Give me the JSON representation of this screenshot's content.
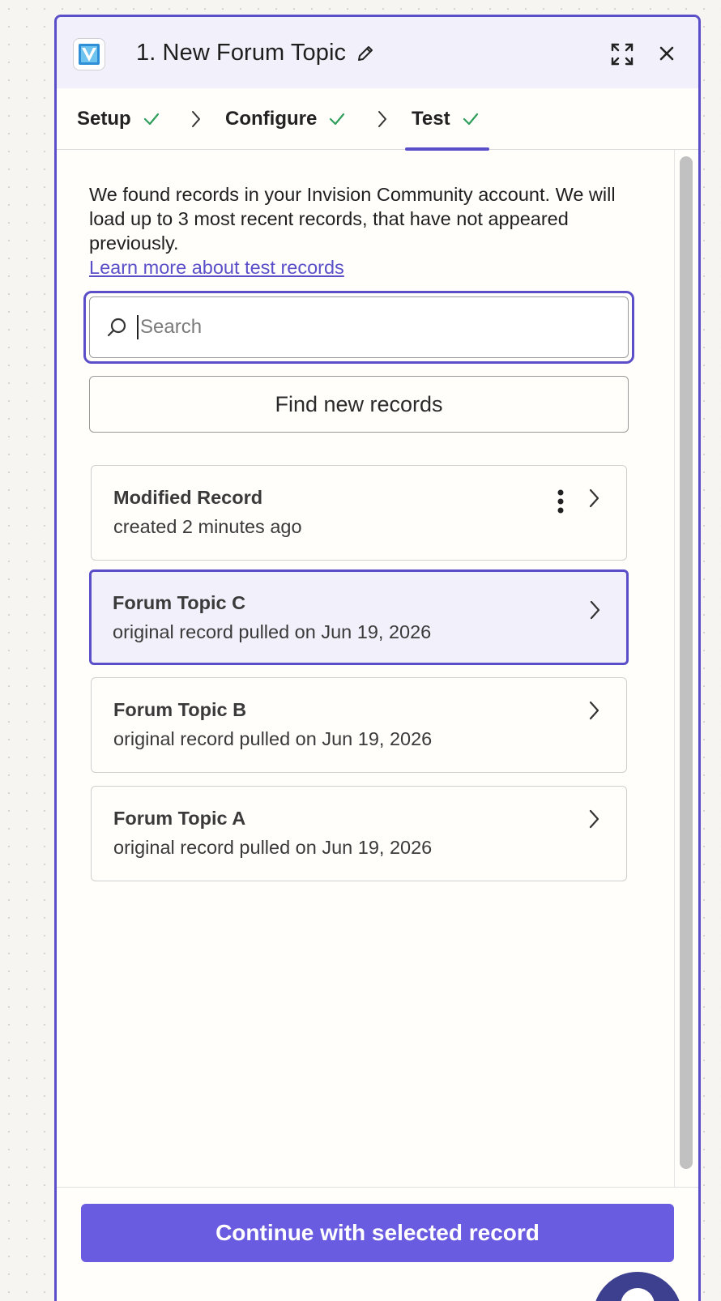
{
  "header": {
    "title": "1. New Forum Topic"
  },
  "steps": [
    {
      "label": "Setup",
      "complete": true
    },
    {
      "label": "Configure",
      "complete": true
    },
    {
      "label": "Test",
      "complete": true,
      "active": true
    }
  ],
  "intro": {
    "text": "We found records in your Invision Community account. We will load up to 3 most recent records, that have not appeared previously.",
    "link": "Learn more about test records"
  },
  "search": {
    "placeholder": "Search",
    "value": ""
  },
  "find_button": "Find new records",
  "records": [
    {
      "title": "Modified Record",
      "subtitle": "created 2 minutes ago",
      "has_menu": true,
      "selected": false
    },
    {
      "title": "Forum Topic C",
      "subtitle": "original record pulled on Jun 19, 2026",
      "selected": true
    },
    {
      "title": "Forum Topic B",
      "subtitle": "original record pulled on Jun 19, 2026",
      "selected": false
    },
    {
      "title": "Forum Topic A",
      "subtitle": "original record pulled on Jun 19, 2026",
      "selected": false
    }
  ],
  "footer": {
    "continue_label": "Continue with selected record"
  },
  "colors": {
    "accent": "#5b4fc9",
    "primary_button": "#6a5ce0",
    "check": "#2f9e5b",
    "selected_bg": "#f2f1fb"
  }
}
